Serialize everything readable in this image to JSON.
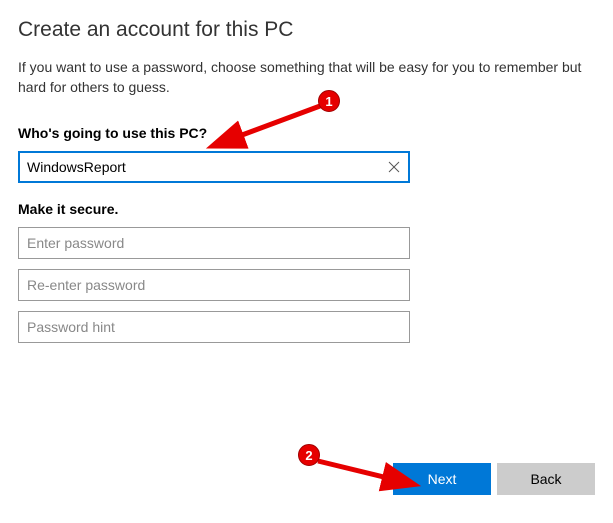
{
  "title": "Create an account for this PC",
  "description": "If you want to use a password, choose something that will be easy for you to remember but hard for others to guess.",
  "section_user": {
    "label": "Who's going to use this PC?",
    "username_value": "WindowsReport"
  },
  "section_secure": {
    "label": "Make it secure.",
    "password_placeholder": "Enter password",
    "confirm_placeholder": "Re-enter password",
    "hint_placeholder": "Password hint"
  },
  "buttons": {
    "next": "Next",
    "back": "Back"
  },
  "annotations": {
    "badge1": "1",
    "badge2": "2"
  },
  "colors": {
    "accent": "#0078d7",
    "annotation": "#e60000"
  }
}
